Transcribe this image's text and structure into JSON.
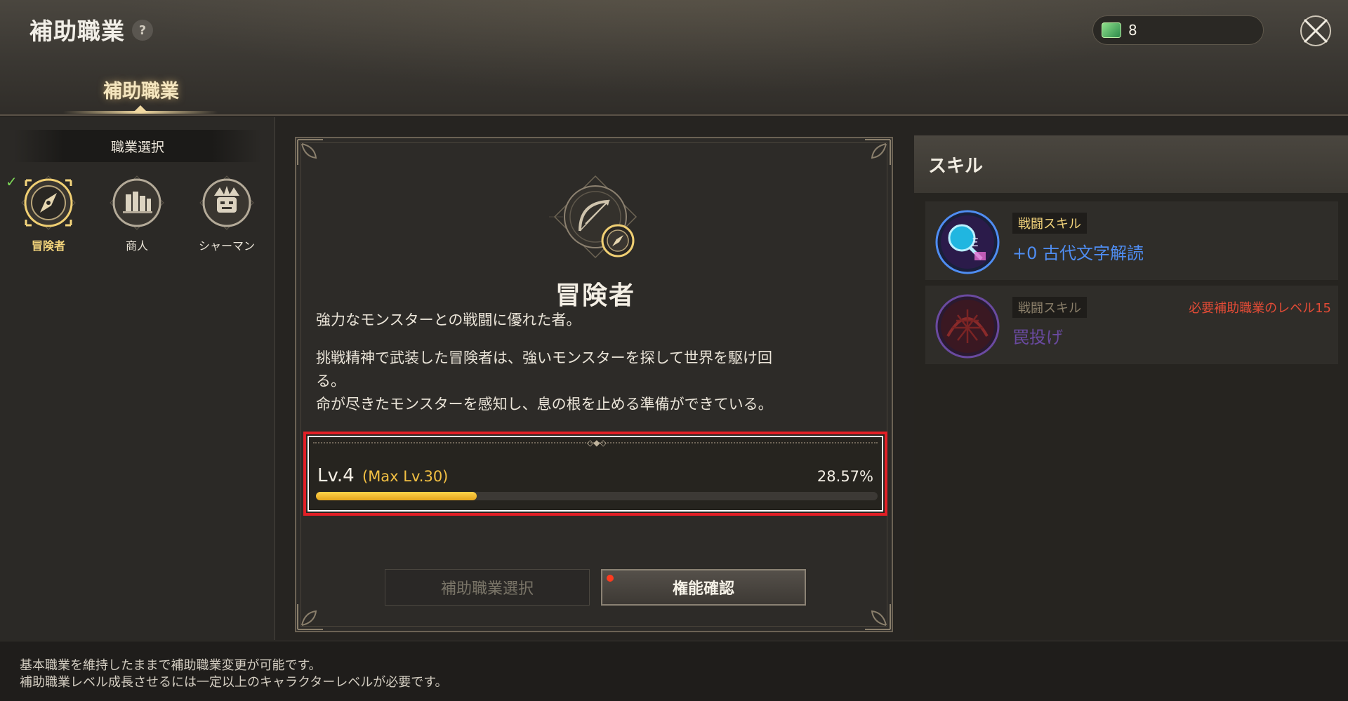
{
  "header": {
    "title": "補助職業",
    "help_label": "?",
    "currency_value": "8",
    "tab_label": "補助職業"
  },
  "sidebar": {
    "section_title": "職業選択",
    "jobs": [
      {
        "label": "冒険者",
        "icon": "compass-icon",
        "selected": true
      },
      {
        "label": "商人",
        "icon": "coins-icon",
        "selected": false
      },
      {
        "label": "シャーマン",
        "icon": "totem-mask-icon",
        "selected": false
      }
    ]
  },
  "job_detail": {
    "name": "冒険者",
    "summary": "強力なモンスターとの戦闘に優れた者。",
    "desc_line1": "挑戦精神で武装した冒険者は、強いモンスターを探して世界を駆け回",
    "desc_line2": "る。",
    "desc_line3": "命が尽きたモンスターを感知し、息の根を止める準備ができている。",
    "level_text": "Lv.4",
    "max_level_text": "(Max Lv.30)",
    "progress_text": "28.57%",
    "progress_fraction": 0.2857,
    "select_button": "補助職業選択",
    "confirm_button": "権能確認"
  },
  "skills": {
    "title": "スキル",
    "items": [
      {
        "type": "戦闘スキル",
        "name": "+0 古代文字解読",
        "requirement": "",
        "locked": false
      },
      {
        "type": "戦闘スキル",
        "name": "罠投げ",
        "requirement": "必要補助職業のレベル15",
        "locked": true
      }
    ]
  },
  "footer": {
    "line1": "基本職業を維持したままで補助職業変更が可能です。",
    "line2": "補助職業レベル成長させるには一定以上のキャラクターレベルが必要です。"
  },
  "colors": {
    "accent_gold": "#f2c043",
    "progress_yellow": "#ffd34a",
    "highlight_red": "#e21f26",
    "skill_blue": "#4f8df2",
    "locked_purple": "#6a4aa0",
    "requirement_red": "#e24b36"
  }
}
